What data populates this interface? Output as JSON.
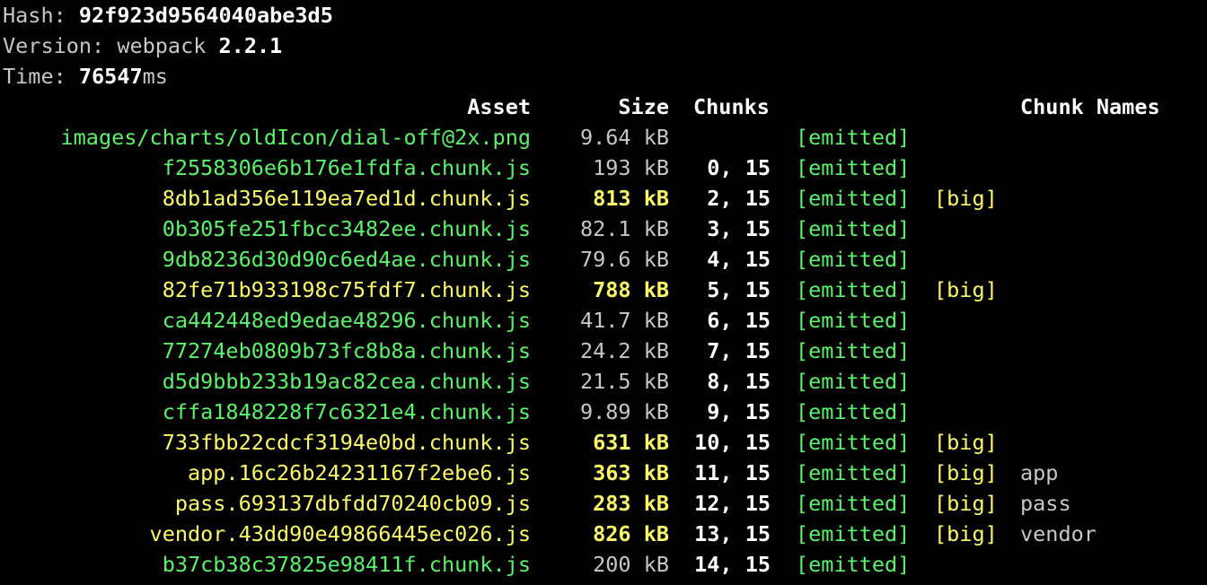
{
  "build": {
    "hash_label": "Hash: ",
    "hash_value": "92f923d9564040abe3d5",
    "version_label": "Version: webpack ",
    "version_value": "2.2.1",
    "time_label": "Time: ",
    "time_value": "76547",
    "time_unit": "ms"
  },
  "columns": {
    "asset": "Asset",
    "size": "Size",
    "chunks": "Chunks",
    "chunk_names": "Chunk Names"
  },
  "colors": {
    "normal_asset": "#5cf26b",
    "big_asset": "#fbf96a",
    "background": "#000000"
  },
  "assets": [
    {
      "name": "images/charts/oldIcon/dial-off@2x.png",
      "size": "9.64",
      "unit": "kB",
      "chunks": "",
      "status": "[emitted]",
      "flag": "",
      "chunk_name": "",
      "big": false
    },
    {
      "name": "f2558306e6b176e1fdfa.chunk.js",
      "size": "193",
      "unit": "kB",
      "chunks": "0, 15",
      "status": "[emitted]",
      "flag": "",
      "chunk_name": "",
      "big": false
    },
    {
      "name": "8db1ad356e119ea7ed1d.chunk.js",
      "size": "813",
      "unit": "kB",
      "chunks": "2, 15",
      "status": "[emitted]",
      "flag": "[big]",
      "chunk_name": "",
      "big": true
    },
    {
      "name": "0b305fe251fbcc3482ee.chunk.js",
      "size": "82.1",
      "unit": "kB",
      "chunks": "3, 15",
      "status": "[emitted]",
      "flag": "",
      "chunk_name": "",
      "big": false
    },
    {
      "name": "9db8236d30d90c6ed4ae.chunk.js",
      "size": "79.6",
      "unit": "kB",
      "chunks": "4, 15",
      "status": "[emitted]",
      "flag": "",
      "chunk_name": "",
      "big": false
    },
    {
      "name": "82fe71b933198c75fdf7.chunk.js",
      "size": "788",
      "unit": "kB",
      "chunks": "5, 15",
      "status": "[emitted]",
      "flag": "[big]",
      "chunk_name": "",
      "big": true
    },
    {
      "name": "ca442448ed9edae48296.chunk.js",
      "size": "41.7",
      "unit": "kB",
      "chunks": "6, 15",
      "status": "[emitted]",
      "flag": "",
      "chunk_name": "",
      "big": false
    },
    {
      "name": "77274eb0809b73fc8b8a.chunk.js",
      "size": "24.2",
      "unit": "kB",
      "chunks": "7, 15",
      "status": "[emitted]",
      "flag": "",
      "chunk_name": "",
      "big": false
    },
    {
      "name": "d5d9bbb233b19ac82cea.chunk.js",
      "size": "21.5",
      "unit": "kB",
      "chunks": "8, 15",
      "status": "[emitted]",
      "flag": "",
      "chunk_name": "",
      "big": false
    },
    {
      "name": "cffa1848228f7c6321e4.chunk.js",
      "size": "9.89",
      "unit": "kB",
      "chunks": "9, 15",
      "status": "[emitted]",
      "flag": "",
      "chunk_name": "",
      "big": false
    },
    {
      "name": "733fbb22cdcf3194e0bd.chunk.js",
      "size": "631",
      "unit": "kB",
      "chunks": "10, 15",
      "status": "[emitted]",
      "flag": "[big]",
      "chunk_name": "",
      "big": true
    },
    {
      "name": "app.16c26b24231167f2ebe6.js",
      "size": "363",
      "unit": "kB",
      "chunks": "11, 15",
      "status": "[emitted]",
      "flag": "[big]",
      "chunk_name": "app",
      "big": true
    },
    {
      "name": "pass.693137dbfdd70240cb09.js",
      "size": "283",
      "unit": "kB",
      "chunks": "12, 15",
      "status": "[emitted]",
      "flag": "[big]",
      "chunk_name": "pass",
      "big": true
    },
    {
      "name": "vendor.43dd90e49866445ec026.js",
      "size": "826",
      "unit": "kB",
      "chunks": "13, 15",
      "status": "[emitted]",
      "flag": "[big]",
      "chunk_name": "vendor",
      "big": true
    },
    {
      "name": "b37cb38c37825e98411f.chunk.js",
      "size": "200",
      "unit": "kB",
      "chunks": "14, 15",
      "status": "[emitted]",
      "flag": "",
      "chunk_name": "",
      "big": false
    }
  ]
}
